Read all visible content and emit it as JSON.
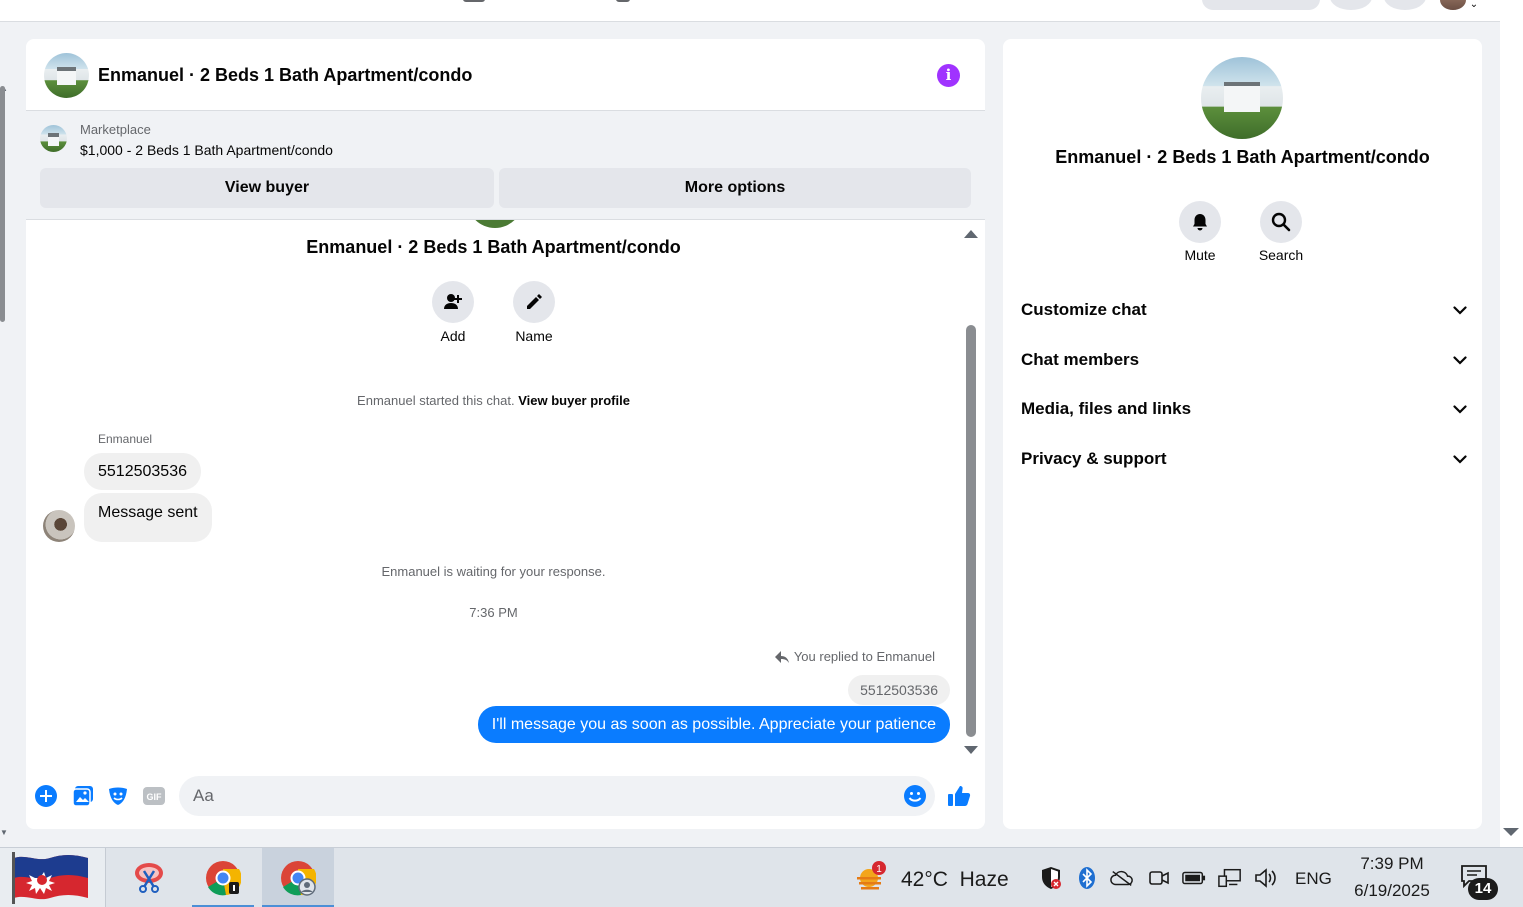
{
  "chat": {
    "header_title": "Enmanuel · 2 Beds 1 Bath Apartment/condo",
    "marketplace_label": "Marketplace",
    "listing": "$1,000 - 2 Beds 1 Bath Apartment/condo",
    "view_buyer_label": "View buyer",
    "more_options_label": "More options"
  },
  "conversation": {
    "title": "Enmanuel · 2 Beds 1 Bath Apartment/condo",
    "add_label": "Add",
    "name_label": "Name",
    "started_text": "Enmanuel started this chat.",
    "view_profile_link": "View buyer profile",
    "sender_name": "Enmanuel",
    "incoming": [
      "5512503536",
      "Message sent"
    ],
    "waiting_text": "Enmanuel is waiting for your response.",
    "timestamp": "7:36 PM",
    "replied_note": "You replied to Enmanuel",
    "quoted_text": "5512503536",
    "outgoing": "I'll message you as soon as possible. Appreciate your patience"
  },
  "composer": {
    "placeholder": "Aa"
  },
  "info_panel": {
    "title": "Enmanuel · 2 Beds 1 Bath Apartment/condo",
    "mute_label": "Mute",
    "search_label": "Search",
    "sections": [
      "Customize chat",
      "Chat members",
      "Media, files and links",
      "Privacy & support"
    ]
  },
  "taskbar": {
    "weather_badge": "1",
    "weather_temp": "42°C",
    "weather_desc": "Haze",
    "language": "ENG",
    "time": "7:39 PM",
    "date": "6/19/2025",
    "notification_count": "14"
  },
  "colors": {
    "messenger_blue": "#0a7cff",
    "info_purple": "#a033ff",
    "bubble_gray": "#f0f0f0"
  }
}
